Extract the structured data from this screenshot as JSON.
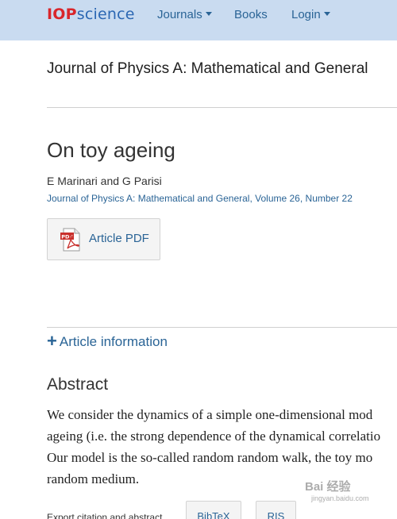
{
  "header": {
    "logo_iop": "IOP",
    "logo_science": "science",
    "nav": [
      {
        "label": "Journals",
        "has_dropdown": true
      },
      {
        "label": "Books",
        "has_dropdown": false
      },
      {
        "label": "Login",
        "has_dropdown": true
      }
    ]
  },
  "journal": {
    "title": "Journal of Physics A: Mathematical and General"
  },
  "article": {
    "title": "On toy ageing",
    "authors": "E Marinari and G Parisi",
    "citation_journal": "Journal of Physics A: Mathematical and General",
    "citation_volume": "Volume 26",
    "citation_number": "Number 22",
    "citation_sep": ", ",
    "pdf_label": "Article PDF",
    "pdf_icon_text": "PDF"
  },
  "info_toggle": {
    "icon": "plus-icon",
    "label": "Article information"
  },
  "abstract": {
    "heading": "Abstract",
    "lines": [
      "We consider the dynamics of a simple one-dimensional mod",
      "ageing (i.e. the strong dependence of the dynamical correlatio",
      "Our model is the so-called random random walk, the toy mo",
      "random medium."
    ]
  },
  "export": {
    "label": "Export citation and abstract",
    "bibtex": "BibTeX",
    "ris": "RIS"
  },
  "watermark": {
    "text": "Bai 经验",
    "sub": "jingyan.baidu.com"
  },
  "colors": {
    "header_bg": "#c9dbf0",
    "link": "#2a6496",
    "logo_red": "#d9262b",
    "logo_blue": "#2b67b3"
  }
}
